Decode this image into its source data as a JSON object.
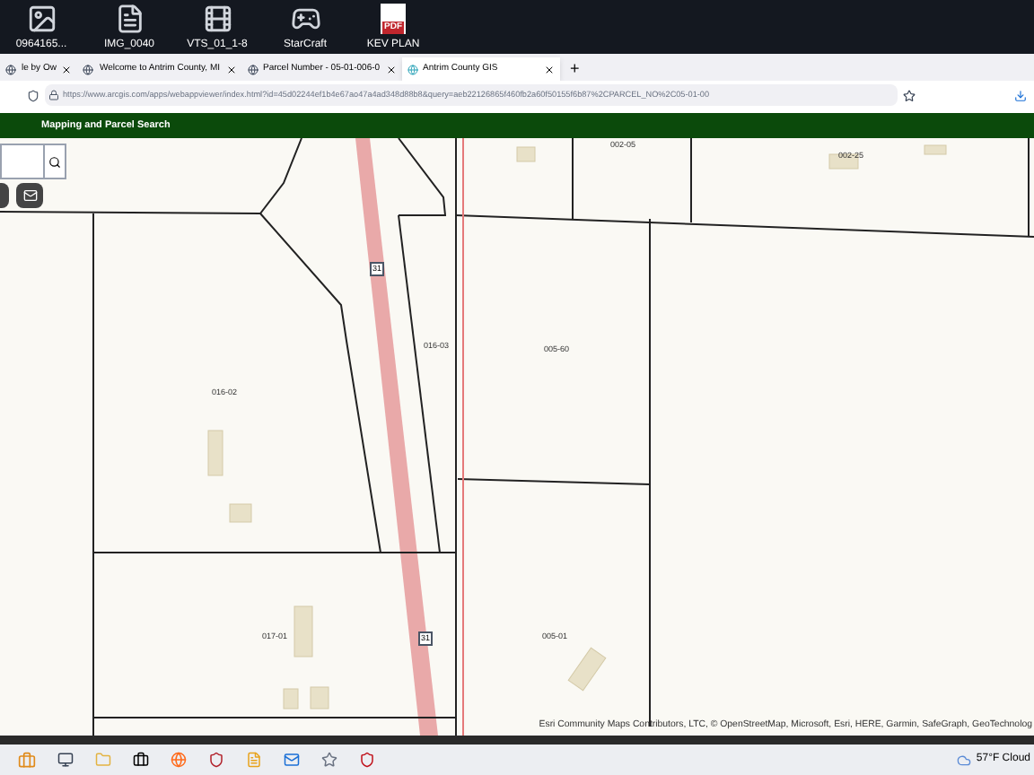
{
  "desktop": {
    "icons": [
      {
        "kind": "photo",
        "label": "0964165..."
      },
      {
        "kind": "document",
        "label": "IMG_0040"
      },
      {
        "kind": "video",
        "label": "VTS_01_1-8"
      },
      {
        "kind": "game",
        "label": "StarCraft"
      },
      {
        "kind": "pdf",
        "label": "KEV PLAN",
        "badge": "PDF"
      }
    ]
  },
  "browser": {
    "tabs": [
      {
        "title": "le by Ow",
        "selected": false
      },
      {
        "title": "Welcome to Antrim County, MI",
        "selected": false
      },
      {
        "title": "Parcel Number - 05-01-006-0",
        "selected": false
      },
      {
        "title": "Antrim County GIS",
        "selected": true
      }
    ],
    "new_tab": "+",
    "url": "https://www.arcgis.com/apps/webappviewer/index.html?id=45d02244ef1b4e67ao47a4ad348d88b8&query=aeb22126865f460fb2a60f50155f6b87%2CPARCEL_NO%2C05-01-00"
  },
  "app": {
    "title": "Mapping and Parcel Search"
  },
  "map": {
    "parcels": [
      "002-05",
      "002-25",
      "016-02",
      "016-03",
      "005-60",
      "017-01",
      "005-01"
    ],
    "route_shields": [
      "31",
      "31"
    ],
    "attribution": "Esri Community Maps Contributors, LTC, © OpenStreetMap, Microsoft, Esri, HERE, Garmin, SafeGraph, GeoTechnolog"
  },
  "taskbar": {
    "weather": "57°F Cloud"
  }
}
